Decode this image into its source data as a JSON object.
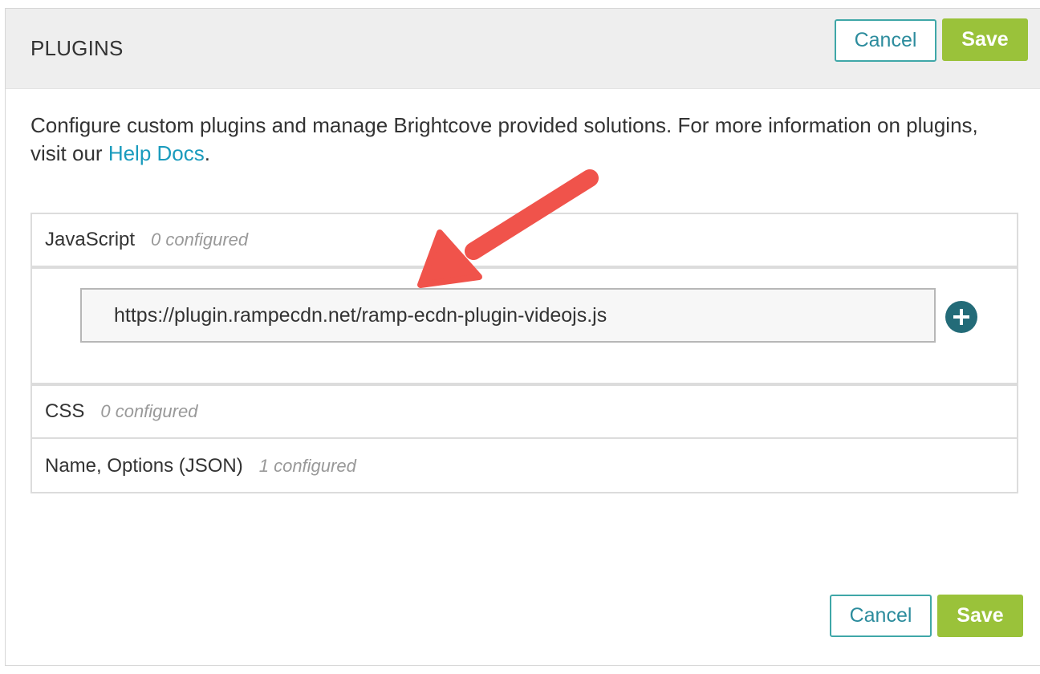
{
  "header": {
    "title": "PLUGINS",
    "cancel_label": "Cancel",
    "save_label": "Save"
  },
  "description": {
    "text": "Configure custom plugins and manage Brightcove provided solutions. For more information on plugins, visit our ",
    "link_text": "Help Docs",
    "suffix": "."
  },
  "sections": {
    "javascript": {
      "name": "JavaScript",
      "count": "0 configured",
      "input_value": "https://plugin.rampecdn.net/ramp-ecdn-plugin-videojs.js",
      "add_icon": "plus-circle-icon"
    },
    "css": {
      "name": "CSS",
      "count": "0 configured"
    },
    "json": {
      "name": "Name, Options (JSON)",
      "count": "1 configured"
    }
  },
  "footer": {
    "cancel_label": "Cancel",
    "save_label": "Save"
  },
  "annotation": {
    "icon": "red-arrow-icon"
  },
  "colors": {
    "header_bg": "#eeeeee",
    "cancel_border": "#3fa7a8",
    "save_bg": "#9ac23a",
    "link": "#1a9bbd",
    "add_button": "#236b78",
    "arrow": "#f0534b"
  }
}
